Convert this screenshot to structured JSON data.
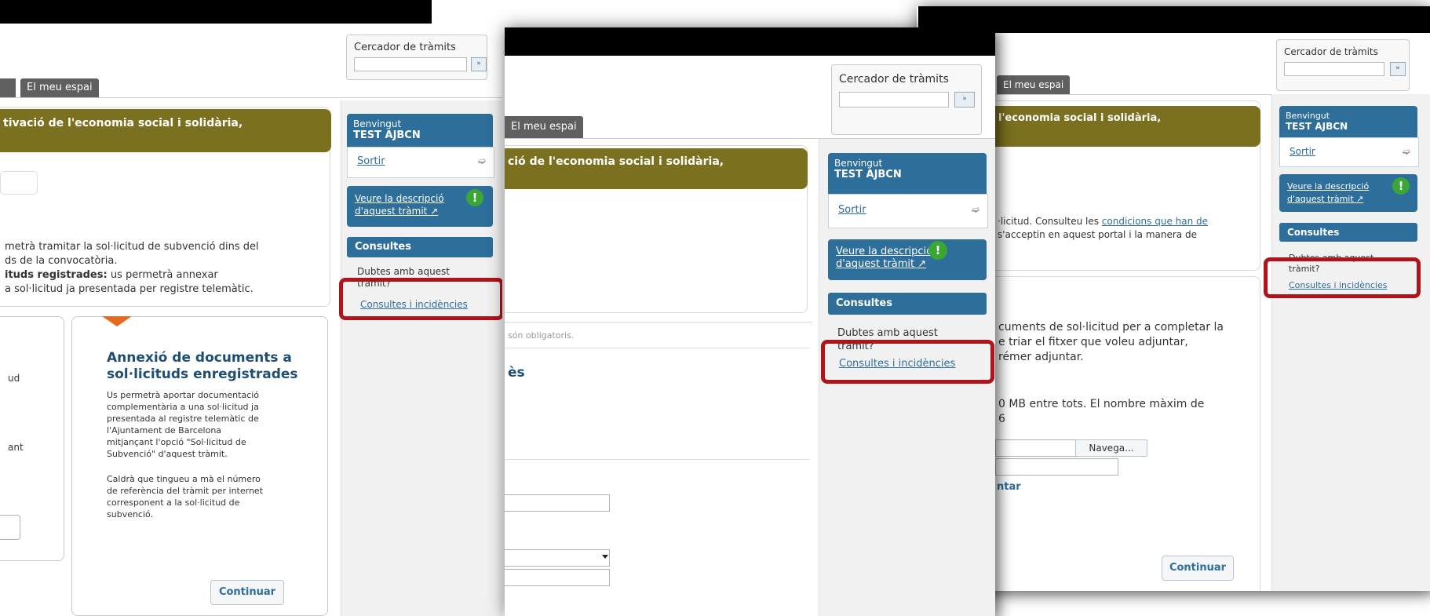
{
  "header": {
    "search_label": "Cercador de tràmits",
    "search_placeholder": "",
    "search_button": "»",
    "tab_label": "El meu espai"
  },
  "sidebar": {
    "welcome_label": "Benvingut",
    "user_name": "TEST AJBCN",
    "logout_label": "Sortir",
    "logout_icon": "➫",
    "description_link_line1": "Veure la descripció",
    "description_link_line2": "d'aquest tràmit ↗",
    "alert_icon": "!",
    "consultes_title": "Consultes",
    "doubts_text_line1": "Dubtes amb aquest",
    "doubts_text_line2": "tràmit?",
    "incidents_link": "Consultes i incidències"
  },
  "panel1": {
    "banner_title": "tivació de l'economia social i solidària,",
    "body_line1": "metrà tramitar la sol·licitud de subvenció dins del",
    "body_line2": "ds de la convocatòria.",
    "body_line3_bold": "ituds registrades:",
    "body_line3_rest": " us permetrà annexar",
    "body_line4": "a sol·licitud ja presentada per registre telemàtic.",
    "side_fragment1": "ud",
    "side_fragment2": "ant",
    "card_title_line1": "Annexió de documents a",
    "card_title_line2": "sol·licituds enregistrades",
    "card_text1": [
      "Us permetrà aportar documentació",
      "complementària a una sol·licitud ja",
      "presentada al registre telemàtic de",
      "l'Ajuntament de Barcelona",
      "mitjançant l'opció \"Sol·licitud de",
      "Subvenció\" d'aquest tràmit."
    ],
    "card_text2": [
      "Caldrà que tingueu a mà el número",
      "de referència del tràmit per internet",
      "corresponent a la sol·licitud de",
      "subvenció."
    ],
    "continue_button": "Continuar"
  },
  "panel2": {
    "banner_title": "ció de l'economia social i solidària,",
    "mandatory_fragment": "són obligatoris.",
    "section_fragment": "ès"
  },
  "panel3": {
    "banner_title": "l'economia social i solidària,",
    "conditions_pre": "·licitud. Consulteu les ",
    "conditions_link": "condicions que han de",
    "conditions_line2": "s'acceptin en aquest portal i la manera de",
    "upload_line1": "cuments de sol·licitud per a completar la",
    "upload_line2": "e triar el fitxer que voleu adjuntar,",
    "upload_line3": "rémer adjuntar.",
    "limit_line1": "0 MB entre tots. El nombre màxim de",
    "limit_line2": "6",
    "browse_button": "Navega...",
    "attach_fragment": "ntar",
    "continue_button": "Continuar"
  },
  "colors": {
    "accent_blue": "#2e6e9b",
    "olive_banner": "#7b7020",
    "highlight_red": "#b0141b"
  }
}
